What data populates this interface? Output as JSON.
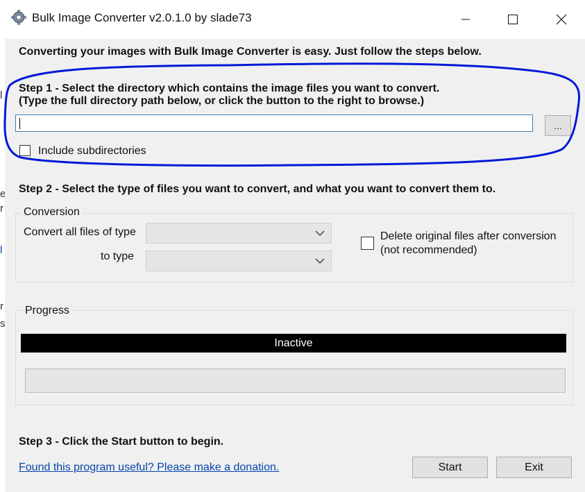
{
  "window": {
    "title": "Bulk Image Converter v2.0.1.0 by slade73",
    "controls": [
      "minimize",
      "maximize",
      "close"
    ]
  },
  "intro": "Converting your images with Bulk Image Converter is easy. Just follow the steps below.",
  "step1": {
    "heading": "Step 1 - Select the directory which contains the image files you want to convert.",
    "subheading": "(Type the full directory path below, or click the button to the right to browse.)",
    "directory_value": "",
    "browse_label": "...",
    "include_subdirectories": {
      "label": "Include subdirectories",
      "checked": false
    }
  },
  "step2": {
    "heading": "Step 2 - Select the type of files you want to convert, and what you want to convert them to.",
    "conversion_group": "Conversion",
    "from_label": "Convert all files of type",
    "from_value": "",
    "to_label": "to type",
    "to_value": "",
    "delete_original": {
      "label_line1": "Delete original files after conversion",
      "label_line2": "(not recommended)",
      "checked": false
    }
  },
  "progress": {
    "group_label": "Progress",
    "status": "Inactive",
    "percent": 0
  },
  "step3": {
    "heading": "Step 3 - Click the Start button to begin."
  },
  "footer": {
    "donation_link": "Found this program useful?  Please make a donation.",
    "start_label": "Start",
    "exit_label": "Exit"
  },
  "annotation": {
    "color": "#0019d6"
  },
  "background_fragments": [
    "l",
    "e",
    "r",
    "l",
    "r",
    "s"
  ]
}
